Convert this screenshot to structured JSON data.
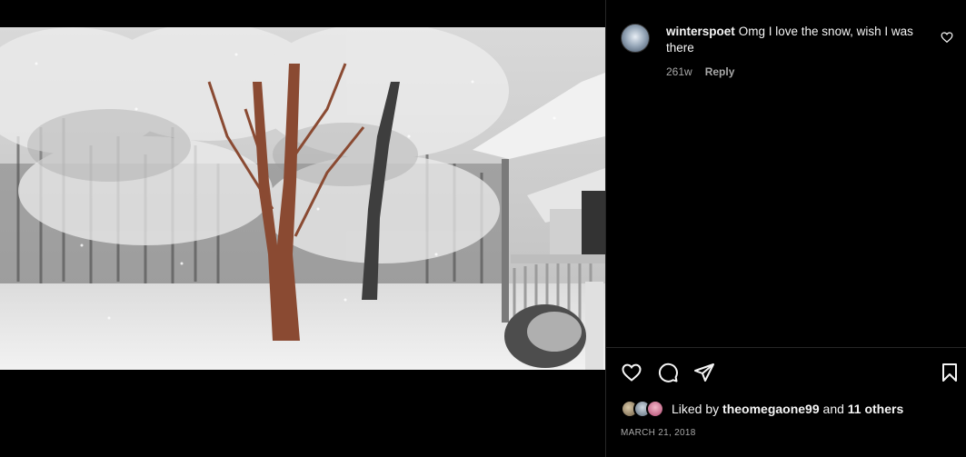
{
  "comment": {
    "username": "winterspoet",
    "text": "Omg I love the snow, wish I was there",
    "time": "261w",
    "reply_label": "Reply"
  },
  "likes": {
    "prefix": "Liked by",
    "user": "theomegaone99",
    "conjunction": "and",
    "others": "11 others"
  },
  "post": {
    "date": "MARCH 21, 2018"
  },
  "icons": {
    "like": "heart-icon",
    "comment": "comment-bubble-icon",
    "share": "paper-plane-icon",
    "save": "bookmark-icon",
    "comment_like": "small-heart-icon"
  },
  "colors": {
    "background": "#000000",
    "text": "#f5f5f5",
    "secondary_text": "#a8a8a8",
    "divider": "#262626"
  }
}
